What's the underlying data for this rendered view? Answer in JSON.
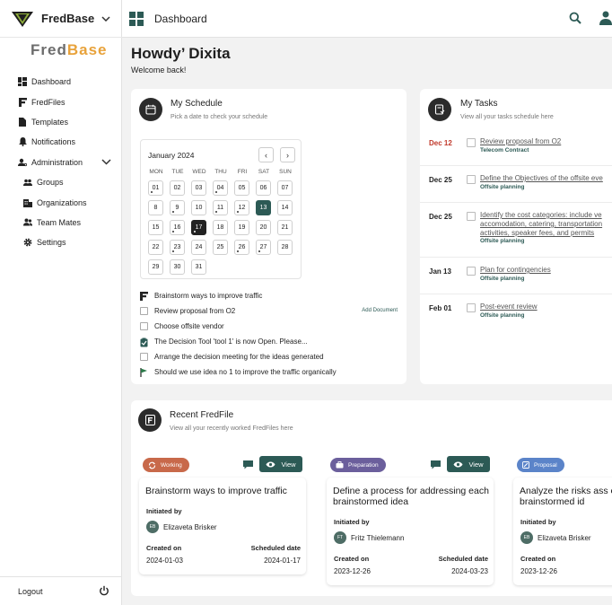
{
  "app": {
    "name": "FredBase",
    "wordmark_a": "Fred",
    "wordmark_b": "Base"
  },
  "sidebar": {
    "items": [
      {
        "label": "Dashboard",
        "icon": "dashboard-icon"
      },
      {
        "label": "FredFiles",
        "icon": "fredfile-icon"
      },
      {
        "label": "Templates",
        "icon": "document-icon"
      },
      {
        "label": "Notifications",
        "icon": "bell-icon"
      },
      {
        "label": "Administration",
        "icon": "admin-icon"
      },
      {
        "label": "Groups",
        "icon": "groups-icon"
      },
      {
        "label": "Organizations",
        "icon": "building-icon"
      },
      {
        "label": "Team Mates",
        "icon": "team-icon"
      },
      {
        "label": "Settings",
        "icon": "gear-icon"
      }
    ],
    "logout": "Logout"
  },
  "header": {
    "title": "Dashboard"
  },
  "greeting": {
    "title": "Howdy’ Dixita",
    "subtitle": "Welcome back!"
  },
  "schedule": {
    "title": "My Schedule",
    "subtitle": "Pick a date to check your schedule",
    "calendar": {
      "month": "January 2024",
      "prev": "‹",
      "next": "›",
      "weekdays": [
        "MON",
        "TUE",
        "WED",
        "THU",
        "FRI",
        "SAT",
        "SUN"
      ],
      "days": [
        "01",
        "02",
        "03",
        "04",
        "05",
        "06",
        "07",
        "8",
        "9",
        "10",
        "11",
        "12",
        "13",
        "14",
        "15",
        "16",
        "17",
        "18",
        "19",
        "20",
        "21",
        "22",
        "23",
        "24",
        "25",
        "26",
        "27",
        "28",
        "29",
        "30",
        "31"
      ]
    },
    "items": [
      {
        "text": "Brainstorm ways to improve traffic",
        "kind": "fredfile"
      },
      {
        "text": "Review proposal from O2",
        "kind": "checkbox",
        "action": "Add Document"
      },
      {
        "text": "Choose offsite vendor",
        "kind": "checkbox"
      },
      {
        "text": "The Decision Tool 'tool 1' is now Open. Please...",
        "kind": "clipboard"
      },
      {
        "text": "Arrange the decision meeting for the ideas generated",
        "kind": "checkbox"
      },
      {
        "text": "Should we use idea no 1 to improve the traffic organically",
        "kind": "flag"
      }
    ]
  },
  "tasks": {
    "title": "My Tasks",
    "subtitle": "View all your tasks schedule here",
    "items": [
      {
        "date": "Dec 12",
        "title": "Review proposal from O2",
        "tag": "Telecom Contract"
      },
      {
        "date": "Dec 25",
        "title": "Define the Objectives of the offsite eve",
        "tag": "Offsite planning"
      },
      {
        "date": "Dec 25",
        "title_lines": [
          "Identify the cost categories: include ve",
          "accomodation, catering, transportation",
          "activities, speaker fees, and permits"
        ],
        "tag": "Offsite planning"
      },
      {
        "date": "Jan 13",
        "title": "Plan for contingencies",
        "tag": "Offsite planning"
      },
      {
        "date": "Feb 01",
        "title": "Post-event review",
        "tag": "Offsite planning"
      }
    ]
  },
  "recent": {
    "title": "Recent FredFile",
    "subtitle": "View all your recently worked FredFiles here",
    "labels": {
      "initiated_by": "Initiated by",
      "created_on": "Created on",
      "scheduled_date": "Scheduled date",
      "view": "View"
    },
    "files": [
      {
        "status": "Working",
        "status_color": "#c8694a",
        "title": "Brainstorm ways to improve traffic",
        "initials": "EB",
        "initiator": "Elizaveta Brisker",
        "created": "2024-01-03",
        "scheduled": "2024-01-17"
      },
      {
        "status": "Preparation",
        "status_color": "#6b5f9c",
        "title": "Define a process for addressing each brainstormed idea",
        "initials": "FT",
        "initiator": "Fritz Thielemann",
        "created": "2023-12-26",
        "scheduled": "2024-03-23"
      },
      {
        "status": "Proposal",
        "status_color": "#5b84c9",
        "title": "Analyze the risks ass each brainstormed id",
        "initials": "EB",
        "initiator": "Elizaveta Brisker",
        "created": "2023-12-26",
        "scheduled": ""
      }
    ]
  },
  "colors": {
    "accent": "#2c5a55",
    "danger": "#c0392b",
    "dark": "#222222"
  }
}
